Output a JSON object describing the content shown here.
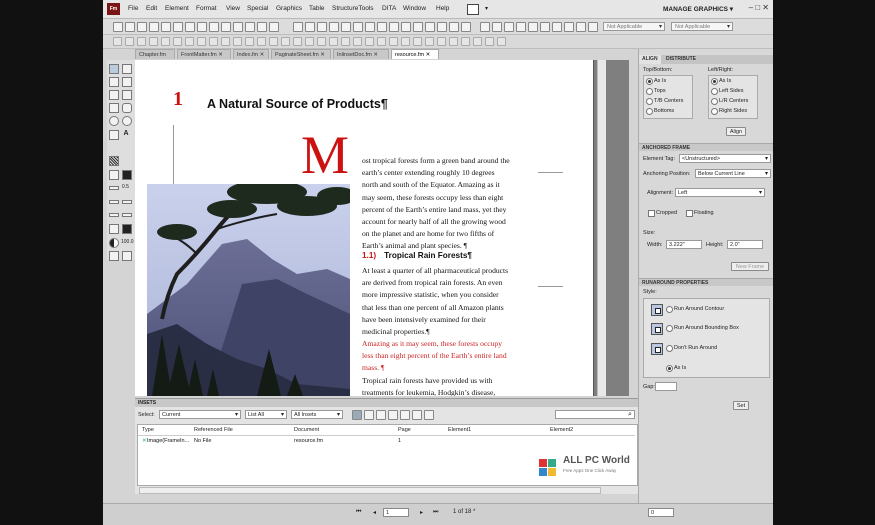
{
  "menubar": {
    "logo": "Fm",
    "items": [
      "File",
      "Edit",
      "Element",
      "Format",
      "View",
      "Special",
      "Graphics",
      "Table",
      "StructureTools",
      "DITA",
      "Window",
      "Help"
    ],
    "workspace": "MANAGE GRAPHICS ▾",
    "window_controls": "–  □  ✕"
  },
  "toolbar": {
    "dropdown1": "Not Applicable",
    "dropdown2": "Not Applicable"
  },
  "tabs": [
    {
      "label": "Chapter.fm ✕"
    },
    {
      "label": "FrontMatter.fm ✕"
    },
    {
      "label": "Index.fm ✕"
    },
    {
      "label": "PaginateSheet.fm ✕"
    },
    {
      "label": "InlinsetDoc.fm ✕"
    },
    {
      "label": "resource.fm ✕"
    }
  ],
  "tools": {
    "line_width": "0.5",
    "zoom": "100.0"
  },
  "document": {
    "chapter_number": "1",
    "chapter_title": "A Natural Source of Products¶",
    "drop_cap": "M",
    "para1": [
      "ost tropical forests form a green band around the",
      "earth’s center extending roughly 10 degrees",
      "north and south of the Equator. Amazing as it",
      "may seem, these forests occupy less than eight",
      "percent of the Earth’s entire land mass, yet they",
      "account for nearly half of all the growing wood",
      "on the planet and are home for two fifths of",
      "Earth’s animal and plant species. ¶"
    ],
    "heading_num": "1.1)",
    "heading_text": "Tropical Rain Forests¶",
    "para2": [
      "At least a quarter of all pharmaceutical products",
      "are derived from tropical rain forests. An even",
      "more impressive statistic, when you consider",
      "that less than one percent of all Amazon plants",
      "have been intensively examined for their",
      "medicinal properties.¶"
    ],
    "para3": [
      "Amazing as it may seem, these forests occupy",
      "less than eight percent of the Earth’s entire land",
      "mass. ¶"
    ],
    "para4": [
      "Tropical rain forests have provided us with",
      "treatments for leukemia, Hodgkin’s disease,"
    ]
  },
  "panel": {
    "tabs": [
      "ALIGN",
      "DISTRIBUTE"
    ],
    "align": {
      "top_bottom_label": "Top/Bottom:",
      "left_right_label": "Left/Right:",
      "tb_options": [
        "As Is",
        "Tops",
        "T/B Centers",
        "Bottoms"
      ],
      "lr_options": [
        "As Is",
        "Left Sides",
        "L/R Centers",
        "Right Sides"
      ],
      "align_button": "Align"
    },
    "anchored": {
      "header": "ANCHORED FRAME",
      "element_tag_label": "Element Tag:",
      "element_tag_value": "<Unstructured>",
      "anchoring_label": "Anchoring Position:",
      "anchoring_value": "Below Current Line",
      "alignment_label": "Alignment:",
      "alignment_value": "Left",
      "cropped": "Cropped",
      "floating": "Floating",
      "size_label": "Size:",
      "width_label": "Width:",
      "width_value": "3.222\"",
      "height_label": "Height:",
      "height_value": "2.0\"",
      "new_frame": "New Frame"
    },
    "runaround": {
      "header": "RUNAROUND PROPERTIES",
      "style_label": "Style:",
      "options": [
        "Run Around Contour",
        "Run Around Bounding Box",
        "Don't Run Around",
        "As Is"
      ],
      "gap_label": "Gap:",
      "set_button": "Set"
    }
  },
  "insets": {
    "header": "INSETS",
    "select_label": "Select:",
    "select_value": "Current",
    "list_value": "List All",
    "insets_value": "All Insets",
    "columns": [
      "Type",
      "Referenced File",
      "Document",
      "Page",
      "Element1",
      "Element2"
    ],
    "row": [
      "Image(FrameIn...",
      "No File",
      "resource.fm",
      "1",
      "",
      ""
    ]
  },
  "statusbar": {
    "page_value": "1",
    "page_of": "1 of 18 *",
    "zoom_value": "0"
  },
  "watermark": {
    "title": "ALL PC World",
    "subtitle": "Free Apps One Click Away"
  }
}
